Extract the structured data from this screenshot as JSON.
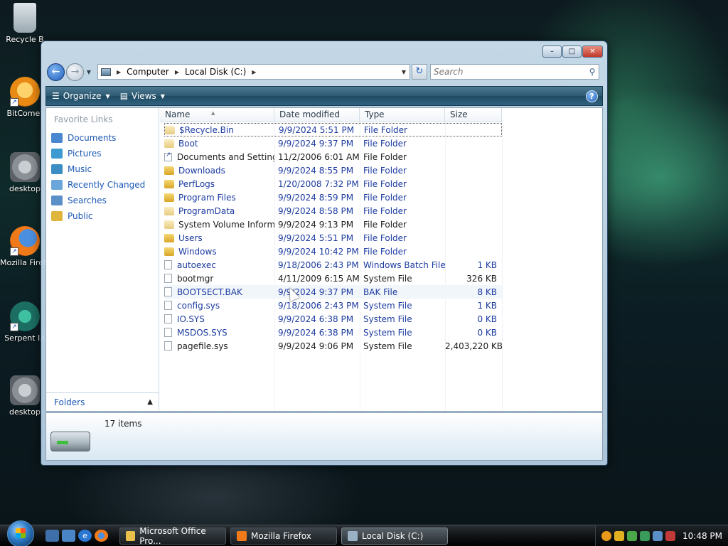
{
  "desktop": {
    "icons": [
      {
        "label": "Recycle B",
        "kind": "recycle"
      },
      {
        "label": "BitComet",
        "kind": "bitcomet"
      },
      {
        "label": "desktop",
        "kind": "gear"
      },
      {
        "label": "Mozilla Firefox",
        "kind": "firefox"
      },
      {
        "label": "Serpent IA",
        "kind": "serpent"
      },
      {
        "label": "desktop",
        "kind": "gear"
      }
    ]
  },
  "window": {
    "title": "Local Disk (C:)",
    "controls": {
      "minimize": "–",
      "maximize": "□",
      "close": "✕"
    },
    "address": {
      "segments": [
        "Computer",
        "Local Disk (C:)"
      ]
    },
    "search": {
      "placeholder": "Search"
    },
    "toolbar": {
      "organize": "Organize",
      "views": "Views",
      "help": "?"
    },
    "nav_pane": {
      "title": "Favorite Links",
      "links": [
        {
          "label": "Documents",
          "color": "#4a87d0"
        },
        {
          "label": "Pictures",
          "color": "#3d9ad0"
        },
        {
          "label": "Music",
          "color": "#3b8dc4"
        },
        {
          "label": "Recently Changed",
          "color": "#6aa6da"
        },
        {
          "label": "Searches",
          "color": "#5b8fc8"
        },
        {
          "label": "Public",
          "color": "#e0b53c"
        }
      ],
      "folders_label": "Folders"
    },
    "columns": {
      "name": "Name",
      "date": "Date modified",
      "type": "Type",
      "size": "Size"
    },
    "files": [
      {
        "name": "$Recycle.Bin",
        "date": "9/9/2024 5:51 PM",
        "type": "File Folder",
        "size": "",
        "icon": "folder-faded",
        "style": "selected"
      },
      {
        "name": "Boot",
        "date": "9/9/2024 9:37 PM",
        "type": "File Folder",
        "size": "",
        "icon": "folder-faded",
        "style": ""
      },
      {
        "name": "Documents and Settings",
        "date": "11/2/2006 6:01 AM",
        "type": "File Folder",
        "size": "",
        "icon": "link",
        "style": "dark"
      },
      {
        "name": "Downloads",
        "date": "9/9/2024 8:55 PM",
        "type": "File Folder",
        "size": "",
        "icon": "folder",
        "style": ""
      },
      {
        "name": "PerfLogs",
        "date": "1/20/2008 7:32 PM",
        "type": "File Folder",
        "size": "",
        "icon": "folder",
        "style": ""
      },
      {
        "name": "Program Files",
        "date": "9/9/2024 8:59 PM",
        "type": "File Folder",
        "size": "",
        "icon": "folder",
        "style": ""
      },
      {
        "name": "ProgramData",
        "date": "9/9/2024 8:58 PM",
        "type": "File Folder",
        "size": "",
        "icon": "folder-faded",
        "style": ""
      },
      {
        "name": "System Volume Inform...",
        "date": "9/9/2024 9:13 PM",
        "type": "File Folder",
        "size": "",
        "icon": "folder-faded",
        "style": "dark"
      },
      {
        "name": "Users",
        "date": "9/9/2024 5:51 PM",
        "type": "File Folder",
        "size": "",
        "icon": "folder",
        "style": ""
      },
      {
        "name": "Windows",
        "date": "9/9/2024 10:42 PM",
        "type": "File Folder",
        "size": "",
        "icon": "folder",
        "style": ""
      },
      {
        "name": "autoexec",
        "date": "9/18/2006 2:43 PM",
        "type": "Windows Batch File",
        "size": "1 KB",
        "icon": "file",
        "style": ""
      },
      {
        "name": "bootmgr",
        "date": "4/11/2009 6:15 AM",
        "type": "System File",
        "size": "326 KB",
        "icon": "file",
        "style": "dark"
      },
      {
        "name": "BOOTSECT.BAK",
        "date": "9/9/2024 9:37 PM",
        "type": "BAK File",
        "size": "8 KB",
        "icon": "file",
        "style": "hover"
      },
      {
        "name": "config.sys",
        "date": "9/18/2006 2:43 PM",
        "type": "System File",
        "size": "1 KB",
        "icon": "file",
        "style": ""
      },
      {
        "name": "IO.SYS",
        "date": "9/9/2024 6:38 PM",
        "type": "System File",
        "size": "0 KB",
        "icon": "file",
        "style": ""
      },
      {
        "name": "MSDOS.SYS",
        "date": "9/9/2024 6:38 PM",
        "type": "System File",
        "size": "0 KB",
        "icon": "file",
        "style": ""
      },
      {
        "name": "pagefile.sys",
        "date": "9/9/2024 9:06 PM",
        "type": "System File",
        "size": "2,403,220 KB",
        "icon": "file",
        "style": "dark"
      }
    ],
    "details": {
      "item_count": "17 items"
    }
  },
  "taskbar": {
    "tasks": [
      {
        "label": "Microsoft Office Pro...",
        "color": "#e8c04a",
        "active": false
      },
      {
        "label": "Mozilla Firefox",
        "color": "#f07a1a",
        "active": false
      },
      {
        "label": "Local Disk (C:)",
        "color": "#9ab0c4",
        "active": true
      }
    ],
    "clock": "10:48 PM"
  }
}
